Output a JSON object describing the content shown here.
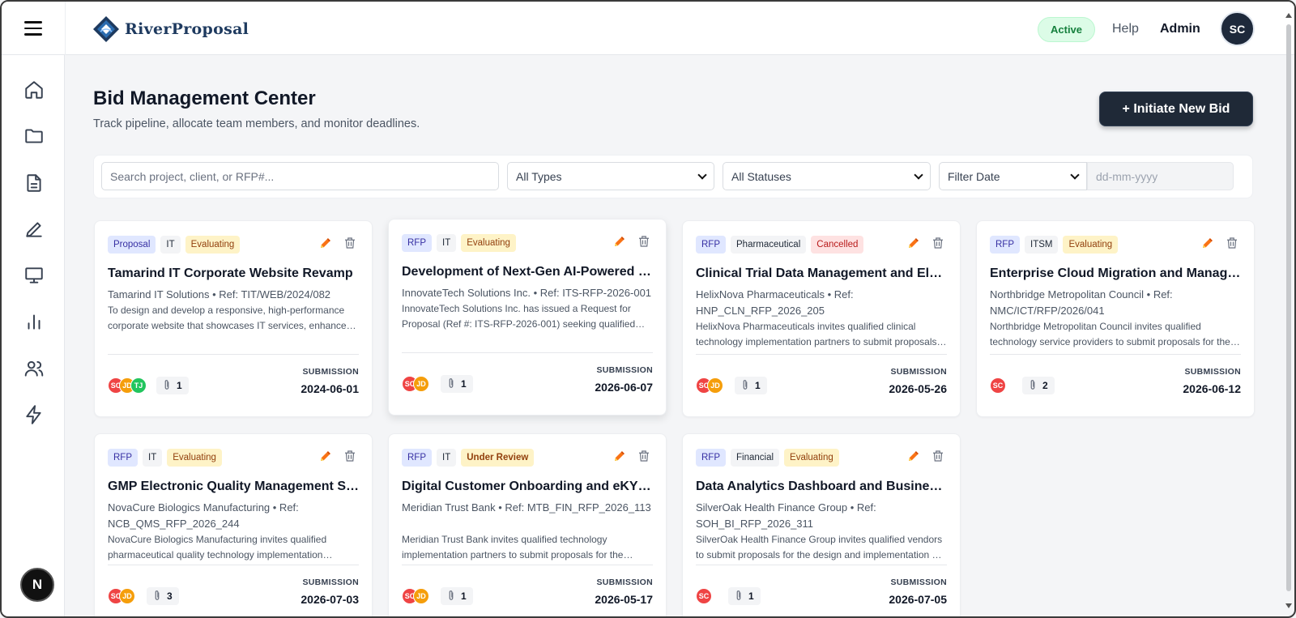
{
  "brand": {
    "name": "RiverProposal"
  },
  "header": {
    "status": "Active",
    "help": "Help",
    "user": "Admin",
    "avatar": "SC"
  },
  "sidebar": {
    "icons": [
      "home-icon",
      "folder-icon",
      "document-icon",
      "pen-icon",
      "monitor-icon",
      "bar-chart-icon",
      "users-icon",
      "lightning-icon"
    ]
  },
  "dev_badge": "N",
  "page": {
    "title": "Bid Management Center",
    "subtitle": "Track pipeline, allocate team members, and monitor deadlines.",
    "new_bid": "+ Initiate New Bid"
  },
  "filters": {
    "search_placeholder": "Search project, client, or RFP#...",
    "type": "All Types",
    "status": "All Statuses",
    "date_filter": "Filter Date",
    "date_placeholder": "dd-mm-yyyy"
  },
  "bids": [
    {
      "doc": "Proposal",
      "category": "IT",
      "status": "Evaluating",
      "title": "Tamarind IT Corporate Website Revamp",
      "meta": "Tamarind IT Solutions • Ref: TIT/WEB/2024/082",
      "description": "To design and develop a responsive, high-performance corporate website that showcases IT services, enhances brand presence, and generates leads.",
      "members": [
        "SC",
        "JD",
        "TJ"
      ],
      "attachments": "1",
      "submission_label": "SUBMISSION",
      "submission_date": "2024-06-01"
    },
    {
      "doc": "RFP",
      "category": "IT",
      "status": "Evaluating",
      "title": "Development of Next-Gen AI-Powered Platform",
      "meta": "InnovateTech Solutions Inc. • Ref: ITS-RFP-2026-001",
      "description": "InnovateTech Solutions Inc. has issued a Request for Proposal (Ref #: ITS-RFP-2026-001) seeking qualified vendors.",
      "members": [
        "SC",
        "JD"
      ],
      "attachments": "1",
      "submission_label": "SUBMISSION",
      "submission_date": "2026-06-07"
    },
    {
      "doc": "RFP",
      "category": "Pharmaceutical",
      "status": "Cancelled",
      "title": "Clinical Trial Data Management and Electronic Data Capture",
      "meta": "HelixNova Pharmaceuticals • Ref: HNP_CLN_RFP_2026_205",
      "description": "HelixNova Pharmaceuticals invites qualified clinical technology implementation partners to submit proposals for the system.",
      "members": [
        "SC",
        "JD"
      ],
      "attachments": "1",
      "submission_label": "SUBMISSION",
      "submission_date": "2026-05-26"
    },
    {
      "doc": "RFP",
      "category": "ITSM",
      "status": "Evaluating",
      "title": "Enterprise Cloud Migration and Managed Services",
      "meta": "Northbridge Metropolitan Council • Ref: NMC/ICT/RFP/2026/041",
      "description": "Northbridge Metropolitan Council invites qualified technology service providers to submit proposals for the migration.",
      "members": [
        "SC"
      ],
      "attachments": "2",
      "submission_label": "SUBMISSION",
      "submission_date": "2026-06-12"
    },
    {
      "doc": "RFP",
      "category": "IT",
      "status": "Evaluating",
      "title": "GMP Electronic Quality Management System",
      "meta": "NovaCure Biologics Manufacturing • Ref: NCB_QMS_RFP_2026_244",
      "description": "NovaCure Biologics Manufacturing invites qualified pharmaceutical quality technology implementation partners.",
      "members": [
        "SC",
        "JD"
      ],
      "attachments": "3",
      "submission_label": "SUBMISSION",
      "submission_date": "2026-07-03"
    },
    {
      "doc": "RFP",
      "category": "IT",
      "status": "Under Review",
      "title": "Digital Customer Onboarding and eKYC Platform",
      "meta": "Meridian Trust Bank • Ref: MTB_FIN_RFP_2026_113",
      "description": "Meridian Trust Bank invites qualified technology implementation partners to submit proposals for the platform.",
      "members": [
        "SC",
        "JD"
      ],
      "attachments": "1",
      "submission_label": "SUBMISSION",
      "submission_date": "2026-05-17"
    },
    {
      "doc": "RFP",
      "category": "Financial",
      "status": "Evaluating",
      "title": "Data Analytics Dashboard and Business Intelligence",
      "meta": "SilverOak Health Finance Group • Ref: SOH_BI_RFP_2026_311",
      "description": "SilverOak Health Finance Group invites qualified vendors to submit proposals for the design and implementation of the dashboard.",
      "members": [
        "SC"
      ],
      "attachments": "1",
      "submission_label": "SUBMISSION",
      "submission_date": "2026-07-05"
    }
  ]
}
